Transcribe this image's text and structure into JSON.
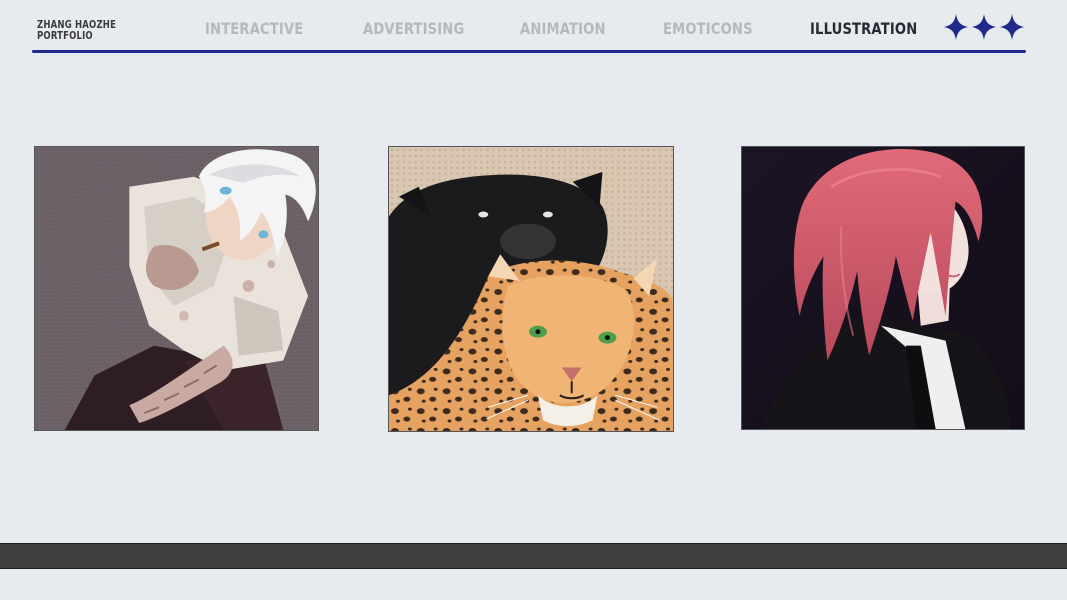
{
  "brand": {
    "line1": "ZHANG HAOZHE",
    "line2": "PORTFOLIO"
  },
  "nav": {
    "items": [
      {
        "label": "INTERACTIVE",
        "active": false
      },
      {
        "label": "ADVERTISING",
        "active": false
      },
      {
        "label": "ANIMATION",
        "active": false
      },
      {
        "label": "EMOTICONS",
        "active": false
      },
      {
        "label": "ILLUSTRATION",
        "active": true
      }
    ]
  },
  "colors": {
    "accent": "#1f2a8c",
    "background": "#e7eaef",
    "nav_inactive": "#b5b8bd",
    "nav_active": "#2a2a33",
    "footer": "#3d3e40"
  },
  "decor": {
    "icons": [
      "four-point-star-icon",
      "four-point-star-icon",
      "four-point-star-icon"
    ]
  },
  "gallery": {
    "items": [
      {
        "subject": "white-haired-figure-illustration"
      },
      {
        "subject": "panther-and-jaguar-illustration"
      },
      {
        "subject": "red-haired-girl-illustration"
      }
    ]
  }
}
